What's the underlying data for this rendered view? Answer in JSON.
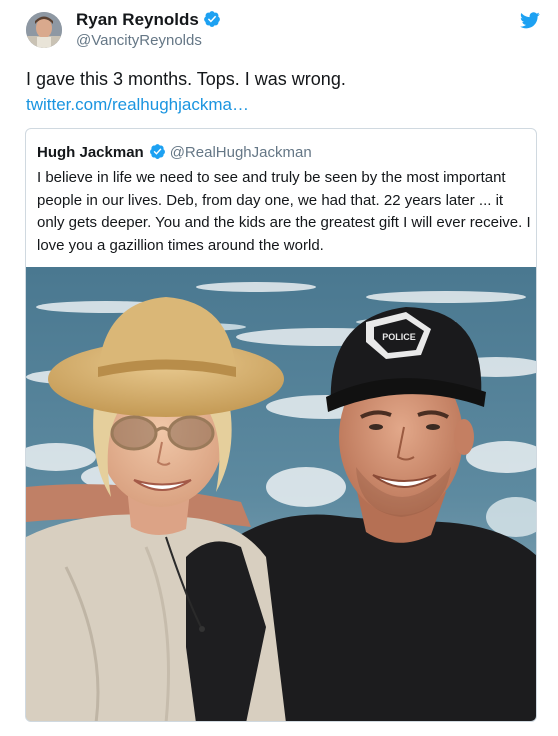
{
  "tweet": {
    "author": {
      "name": "Ryan Reynolds",
      "handle": "@VancityReynolds"
    },
    "text": "I gave this 3 months. Tops. I was wrong.",
    "link": "twitter.com/realhughjackma…"
  },
  "quoted_tweet": {
    "author": {
      "name": "Hugh Jackman",
      "handle": "@RealHughJackman"
    },
    "text": "I believe in life we need to see and truly be seen by the most important people in our lives. Deb, from day one, we had that. 22 years later ... it only gets deeper. You and the kids are the greatest gift I will ever receive. I love you a gazillion times around the world.",
    "photo_cap_text": "POLICE"
  },
  "colors": {
    "link": "#1b95e0",
    "verified": "#1da1f2",
    "handle": "#657786",
    "text": "#14171a",
    "border": "#d0d9e0"
  },
  "icons": [
    "avatar",
    "verified-badge-icon",
    "twitter-bird-icon"
  ]
}
